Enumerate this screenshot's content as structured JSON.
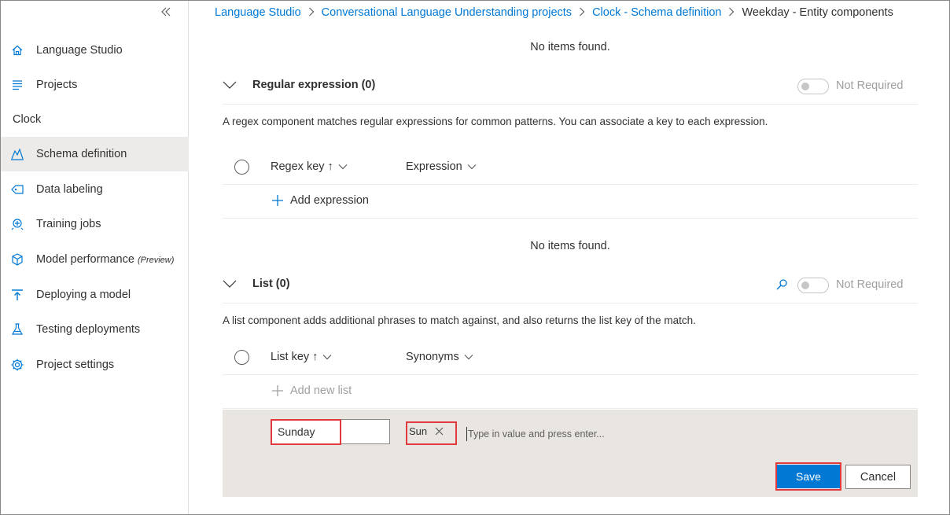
{
  "sidebar": {
    "collapse_icon": "double-chevron-left-icon",
    "top_items": [
      {
        "label": "Language Studio",
        "icon": "home-icon"
      },
      {
        "label": "Projects",
        "icon": "list-icon"
      }
    ],
    "project_name": "Clock",
    "project_items": [
      {
        "label": "Schema definition",
        "icon": "schema-icon",
        "active": true
      },
      {
        "label": "Data labeling",
        "icon": "tag-icon"
      },
      {
        "label": "Training jobs",
        "icon": "training-icon"
      },
      {
        "label": "Model performance",
        "suffix": "(Preview)",
        "icon": "cube-icon"
      },
      {
        "label": "Deploying a model",
        "icon": "deploy-icon"
      },
      {
        "label": "Testing deployments",
        "icon": "flask-icon"
      },
      {
        "label": "Project settings",
        "icon": "settings-gear-icon"
      }
    ]
  },
  "breadcrumb": {
    "items": [
      "Language Studio",
      "Conversational Language Understanding projects",
      "Clock - Schema definition"
    ],
    "current": "Weekday - Entity components"
  },
  "top_empty": "No items found.",
  "regex_section": {
    "title": "Regular expression (0)",
    "toggle_label": "Not Required",
    "description": "A regex component matches regular expressions for common patterns. You can associate a key to each expression.",
    "columns": [
      "Regex key ↑",
      "Expression"
    ],
    "add_label": "Add expression",
    "empty": "No items found."
  },
  "list_section": {
    "title": "List (0)",
    "toggle_label": "Not Required",
    "description": "A list component adds additional phrases to match against, and also returns the list key of the match.",
    "columns": [
      "List key ↑",
      "Synonyms"
    ],
    "add_label": "Add new list",
    "edit": {
      "key_value": "Sunday",
      "synonym_tags": [
        "Sun"
      ],
      "synonym_placeholder": "Type in value and press enter...",
      "save_label": "Save",
      "cancel_label": "Cancel"
    }
  },
  "colors": {
    "accent": "#0078d4",
    "highlight": "#e0393e",
    "panel_bg": "#e9e6e2"
  }
}
